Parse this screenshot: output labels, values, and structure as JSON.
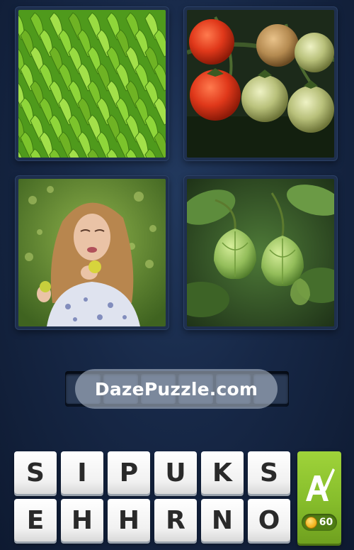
{
  "puzzle": {
    "pictures": [
      {
        "subject": "green-bananas"
      },
      {
        "subject": "ripening-tomatoes"
      },
      {
        "subject": "woman-eating-sour-fruit"
      },
      {
        "subject": "green-husk-cherries"
      }
    ],
    "answer_length": 6
  },
  "watermark": "DazePuzzle.com",
  "keyboard": {
    "row1": [
      "S",
      "I",
      "P",
      "U",
      "K",
      "S"
    ],
    "row2": [
      "E",
      "H",
      "H",
      "R",
      "N",
      "O"
    ]
  },
  "hint": {
    "icon": "letter-a-paintbrush-icon",
    "cost": "60",
    "coin_icon": "coin-icon"
  },
  "colors": {
    "background": "#172847",
    "hint_green": "#8cc42f",
    "key_face": "#f4f4f4"
  }
}
